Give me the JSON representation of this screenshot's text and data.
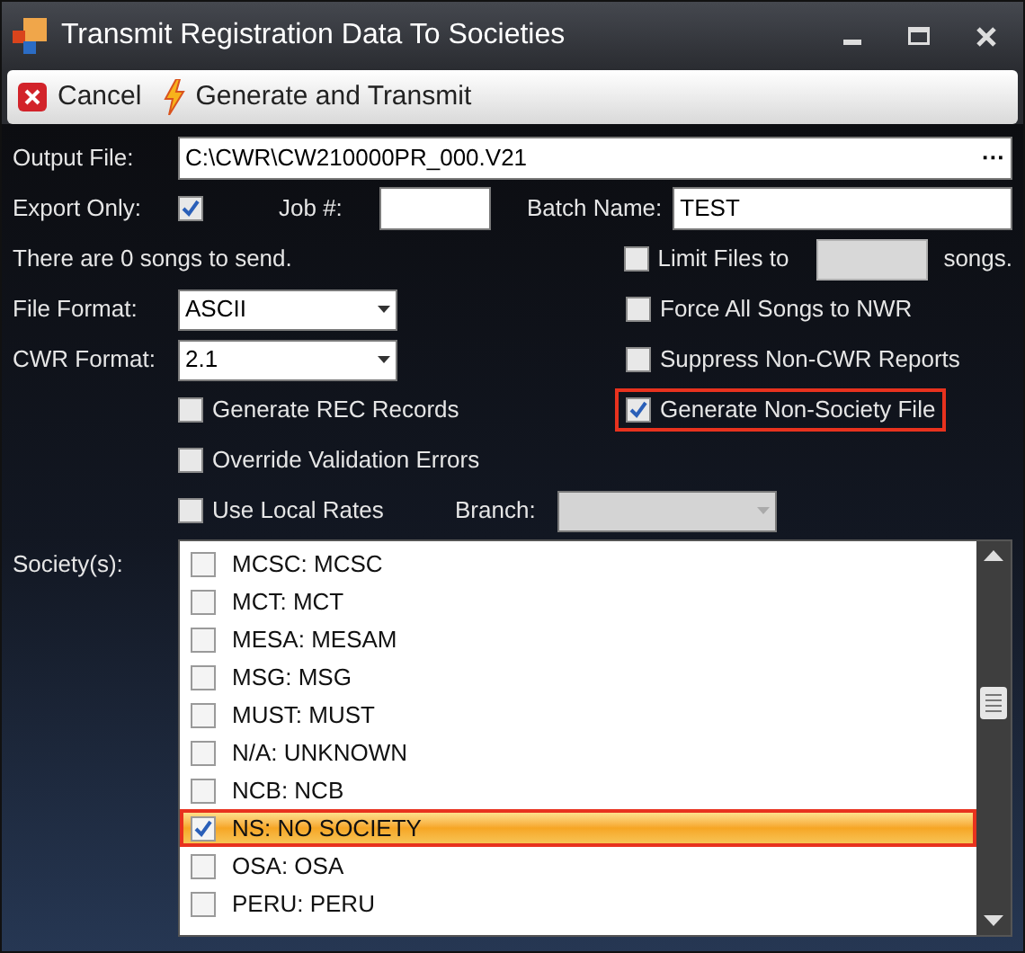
{
  "window": {
    "title": "Transmit Registration Data To Societies"
  },
  "toolbar": [
    {
      "label": "Cancel",
      "kind": "cancel"
    },
    {
      "label": "Generate and Transmit",
      "kind": "generate"
    }
  ],
  "output_file": {
    "label": "Output File:",
    "value": "C:\\CWR\\CW210000PR_000.V21",
    "browse": "···"
  },
  "export_only": {
    "label": "Export Only:",
    "checked": true
  },
  "job": {
    "label": "Job #:"
  },
  "batch_name": {
    "label": "Batch Name:",
    "value": "TEST"
  },
  "songs_message": "There are 0 songs to send.",
  "limit_files": {
    "label": "Limit Files to",
    "suffix": "songs.",
    "checked": false,
    "disabled": true
  },
  "file_format": {
    "label": "File Format:",
    "value": "ASCII"
  },
  "cwr_format": {
    "label": "CWR Format:",
    "value": "2.1"
  },
  "right_options": [
    {
      "label": "Force All Songs to NWR",
      "checked": false,
      "highlighted": false
    },
    {
      "label": "Suppress Non-CWR Reports",
      "checked": false,
      "highlighted": false
    },
    {
      "label": "Generate Non-Society File",
      "checked": true,
      "highlighted": true
    }
  ],
  "left_options": [
    {
      "label": "Generate REC Records",
      "checked": false
    },
    {
      "label": "Override Validation Errors",
      "checked": false
    },
    {
      "label": "Use Local Rates",
      "checked": false
    }
  ],
  "branch": {
    "label": "Branch:",
    "disabled": true
  },
  "societies": {
    "label": "Society(s):",
    "items": [
      {
        "label": "MCSC: MCSC",
        "checked": false,
        "selected": false,
        "highlighted": false
      },
      {
        "label": "MCT: MCT",
        "checked": false,
        "selected": false,
        "highlighted": false
      },
      {
        "label": "MESA: MESAM",
        "checked": false,
        "selected": false,
        "highlighted": false
      },
      {
        "label": "MSG: MSG",
        "checked": false,
        "selected": false,
        "highlighted": false
      },
      {
        "label": "MUST: MUST",
        "checked": false,
        "selected": false,
        "highlighted": false
      },
      {
        "label": "N/A: UNKNOWN",
        "checked": false,
        "selected": false,
        "highlighted": false
      },
      {
        "label": "NCB: NCB",
        "checked": false,
        "selected": false,
        "highlighted": false
      },
      {
        "label": "NS: NO SOCIETY",
        "checked": true,
        "selected": true,
        "highlighted": true
      },
      {
        "label": "OSA: OSA",
        "checked": false,
        "selected": false,
        "highlighted": false
      },
      {
        "label": "PERU: PERU",
        "checked": false,
        "selected": false,
        "highlighted": false
      }
    ]
  }
}
